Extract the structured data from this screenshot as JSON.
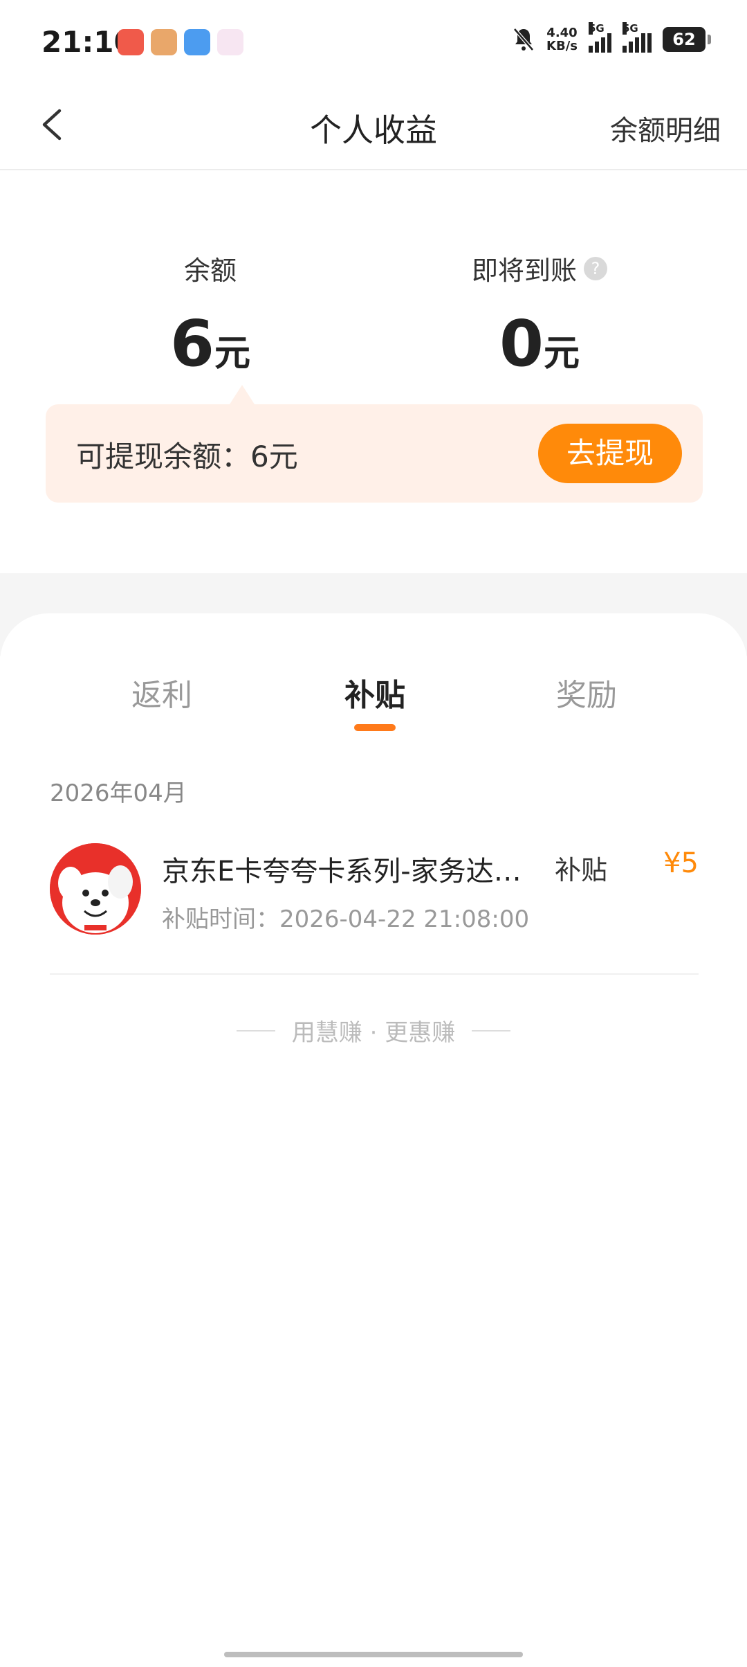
{
  "status_bar": {
    "time": "21:10",
    "net_speed_value": "4.40",
    "net_speed_unit": "KB/s",
    "signal1_label": "5G",
    "signal2_label": "5G",
    "battery": "62",
    "colors": {
      "battery": "#222222"
    }
  },
  "nav": {
    "title": "个人收益",
    "right_link": "余额明细"
  },
  "balance": {
    "label": "余额",
    "value": "6",
    "unit": "元"
  },
  "pending": {
    "label": "即将到账",
    "help_icon": "?",
    "value": "0",
    "unit": "元"
  },
  "withdraw": {
    "text": "可提现余额：6元",
    "button": "去提现",
    "colors": {
      "button": "#ff8a0a",
      "card": "#fff0e8"
    }
  },
  "tabs": [
    {
      "label": "返利"
    },
    {
      "label": "补贴"
    },
    {
      "label": "奖励"
    }
  ],
  "active_tab": "补贴",
  "month": "2026年04月",
  "records": [
    {
      "title": "京东E卡夸夸卡系列-家务达…",
      "time": "补贴时间：2026-04-22 21:08:00",
      "type": "补贴",
      "amount": "¥5"
    }
  ],
  "footer": {
    "slogan": "用慧赚 · 更惠赚"
  }
}
